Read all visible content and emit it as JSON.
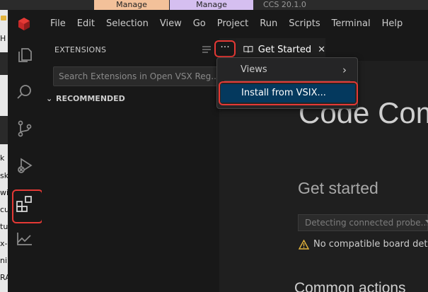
{
  "top_strip": {
    "tab1": "Manage",
    "tab2": "Manage",
    "tab3": "CCS 20.1.0"
  },
  "left_strip_fragments": [
    "H",
    "k",
    "sk",
    "wi",
    "cu",
    "tu",
    "x-",
    "nin",
    "RA"
  ],
  "menu": {
    "items": [
      "File",
      "Edit",
      "Selection",
      "View",
      "Go",
      "Project",
      "Run",
      "Scripts",
      "Terminal",
      "Help"
    ]
  },
  "activity_bar": {
    "icons": [
      "explorer-icon",
      "search-icon",
      "source-control-icon",
      "run-debug-icon",
      "extensions-icon",
      "chart-icon"
    ]
  },
  "sidebar": {
    "title": "EXTENSIONS",
    "search_placeholder": "Search Extensions in Open VSX Reg...",
    "section": "RECOMMENDED",
    "more_label": "···"
  },
  "tab": {
    "label": "Get Started",
    "close": "✕"
  },
  "welcome": {
    "title": "Code Com",
    "get_started": "Get started",
    "probe_placeholder": "Detecting connected probe...",
    "warning": "No compatible board detect",
    "common_actions": "Common actions"
  },
  "context_menu": {
    "views": "Views",
    "views_arrow": "›",
    "install": "Install from VSIX..."
  },
  "colors": {
    "highlight_red": "#e53935",
    "menu_selected": "#04395e"
  }
}
